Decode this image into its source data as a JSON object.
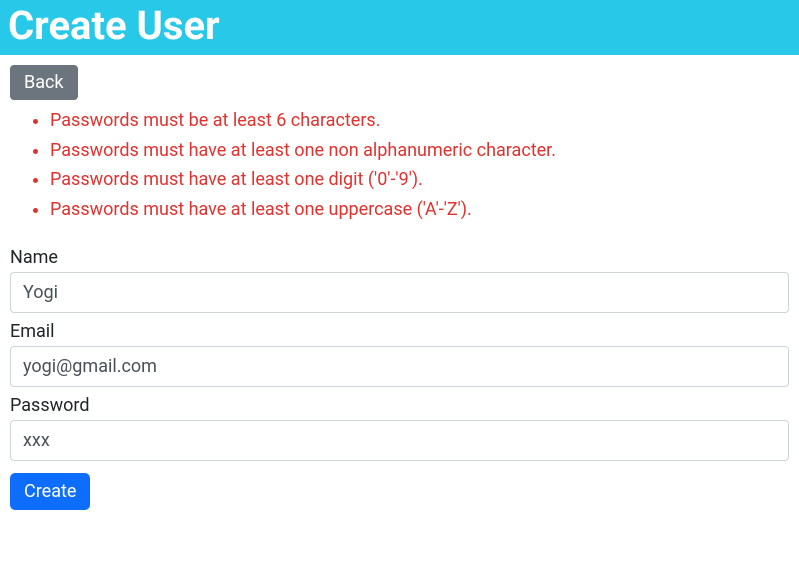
{
  "header": {
    "title": "Create User"
  },
  "buttons": {
    "back": "Back",
    "create": "Create"
  },
  "errors": [
    "Passwords must be at least 6 characters.",
    "Passwords must have at least one non alphanumeric character.",
    "Passwords must have at least one digit ('0'-'9').",
    "Passwords must have at least one uppercase ('A'-'Z')."
  ],
  "form": {
    "name": {
      "label": "Name",
      "value": "Yogi"
    },
    "email": {
      "label": "Email",
      "value": "yogi@gmail.com"
    },
    "password": {
      "label": "Password",
      "value": "xxx"
    }
  }
}
